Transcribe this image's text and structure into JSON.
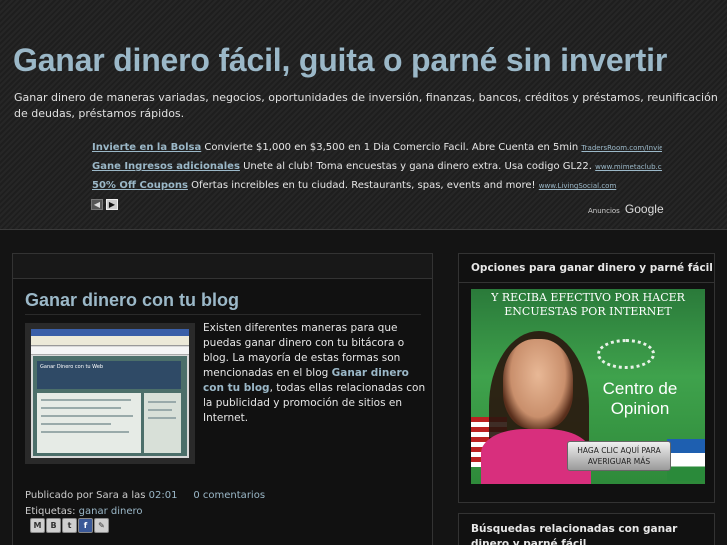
{
  "header": {
    "title": "Ganar dinero fácil, guita o parné sin invertir",
    "description": "Ganar dinero de maneras variadas, negocios, oportunidades de inversión, finanzas, bancos, créditos y préstamos, reunificación de deudas, préstamos rápidos."
  },
  "ads": {
    "items": [
      {
        "title": "Invierte en la Bolsa",
        "text": "Convierte $1,000 en $3,500 en 1 Dia Comercio Facil. Abre Cuenta en 5min",
        "url": "TradersRoom.com/Invierte_Bolsa"
      },
      {
        "title": "Gane Ingresos adicionales",
        "text": "Unete al club! Toma encuestas y gana dinero extra. Usa codigo GL22.",
        "url": "www.mimetaclub.com"
      },
      {
        "title": "50% Off Coupons",
        "text": "Ofertas increibles en tu ciudad. Restaurants, spas, events and more!",
        "url": "www.LivingSocial.com"
      }
    ],
    "prev": "◀",
    "next": "▶",
    "anuncios": "Anuncios",
    "google": "Google"
  },
  "post": {
    "title": "Ganar dinero con tu blog",
    "thumb_caption": "Ganar Dinero con tu Web",
    "body_before": "Existen diferentes maneras para que puedas ganar dinero con tu bitácora o blog. La mayoría de estas formas son mencionadas en el blog ",
    "body_link": "Ganar dinero con tu blog",
    "body_after": ", todas ellas relacionadas con la publicidad y promoción de sitios en Internet.",
    "published_prefix": "Publicado por Sara a las",
    "time": "02:01",
    "comments": "0 comentarios",
    "labels_prefix": "Etiquetas:",
    "label": "ganar dinero",
    "share": [
      "M",
      "B",
      "t",
      "f",
      "✎"
    ]
  },
  "sidebar": {
    "widget1_title": "Opciones para ganar dinero y parné fácil",
    "banner_header": "Y RECIBA EFECTIVO POR HACER ENCUESTAS POR INTERNET",
    "banner_brand": "Centro de Opinion",
    "banner_cta": "HAGA CLIC AQUÍ PARA AVERIGUAR MÁS",
    "widget2_title": "Búsquedas relacionadas con ganar dinero y parné fácil"
  }
}
